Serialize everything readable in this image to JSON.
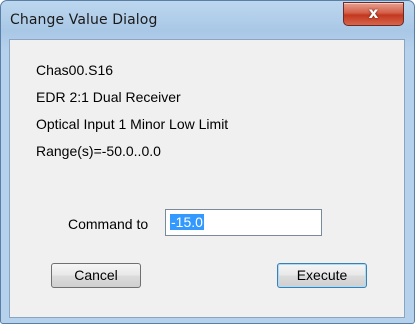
{
  "window": {
    "title": "Change Value Dialog",
    "close_glyph": "x"
  },
  "info": {
    "chassis": "Chas00.S16",
    "device": "EDR 2:1 Dual Receiver",
    "parameter": "Optical Input 1 Minor Low Limit",
    "range": "Range(s)=-50.0..0.0"
  },
  "command": {
    "label": "Command to",
    "value": "-15.0"
  },
  "buttons": {
    "cancel": "Cancel",
    "execute": "Execute"
  },
  "colors": {
    "selection": "#3399ff",
    "close_button": "#c2381f",
    "frame": "#a9c8e6"
  }
}
